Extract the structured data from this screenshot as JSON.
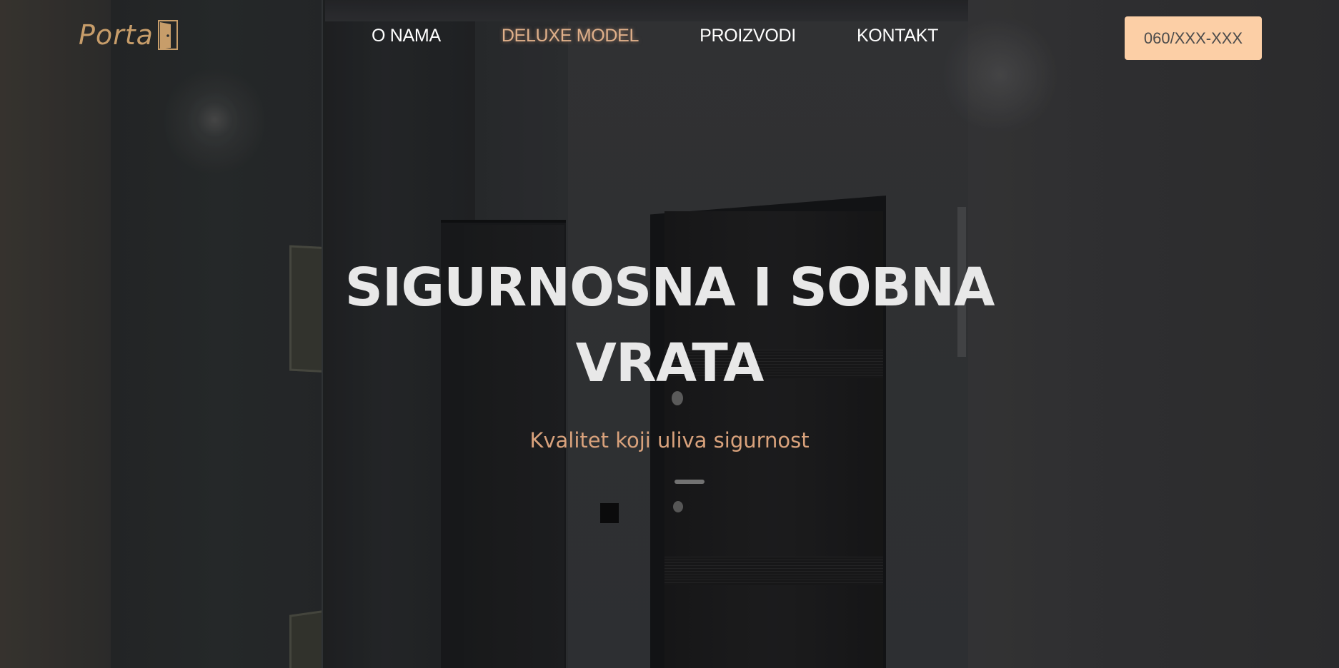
{
  "header": {
    "logo": {
      "text": "Porta",
      "icon": "door-icon"
    },
    "nav": [
      {
        "label": "O NAMA",
        "active": false
      },
      {
        "label": "DELUXE MODEL",
        "active": true
      },
      {
        "label": "PROIZVODI",
        "active": false
      },
      {
        "label": "KONTAKT",
        "active": false
      }
    ],
    "phone_button": "060/XXX-XXX"
  },
  "hero": {
    "title": "SIGURNOSNA I SOBNA VRATA",
    "subtitle": "Kvalitet koji uliva sigurnost"
  },
  "colors": {
    "accent": "#c79d6a",
    "nav_active": "#e0b08a",
    "button_bg": "#fccfa6",
    "subtitle": "#d9a27c",
    "title": "#e8e8e8"
  }
}
